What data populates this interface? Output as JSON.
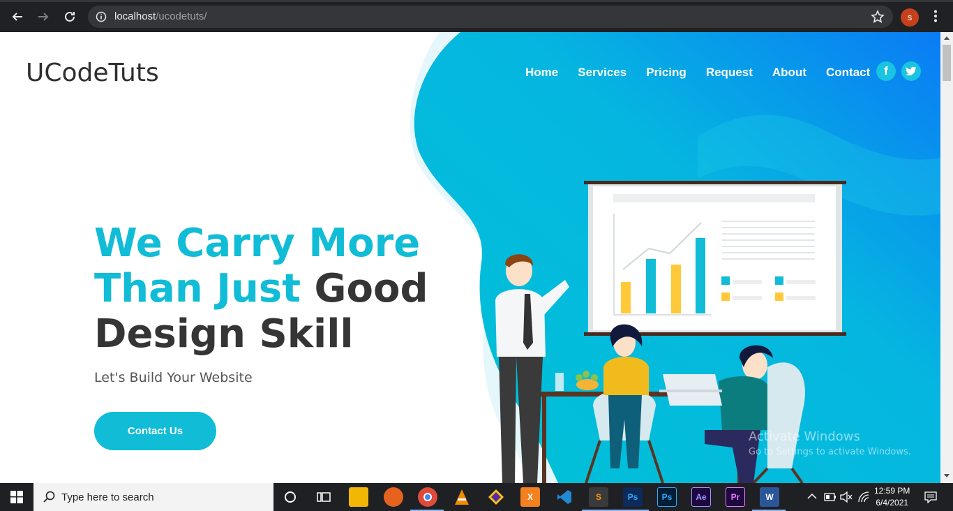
{
  "browser": {
    "url_host": "localhost",
    "url_path": "/ucodetuts/",
    "profile_initial": "s"
  },
  "site": {
    "logo": "UCodeTuts",
    "nav": [
      "Home",
      "Services",
      "Pricing",
      "Request",
      "About",
      "Contact"
    ],
    "social": [
      "f",
      "t"
    ],
    "hero": {
      "line1": "We Carry More",
      "line2_accent": "Than Just",
      "line2_rest": "Good",
      "line3": "Design Skill",
      "subtitle": "Let's Build Your Website",
      "cta": "Contact Us"
    },
    "colors": {
      "accent": "#10bcd6",
      "blob_start": "#00c2d6",
      "blob_end": "#0a7cf5"
    }
  },
  "windows": {
    "watermark_title": "Activate Windows",
    "watermark_sub": "Go to Settings to activate Windows.",
    "search_placeholder": "Type here to search",
    "time": "12:59 PM",
    "date": "6/4/2021",
    "taskbar_icons": [
      "cortana-icon",
      "task-view-icon",
      "file-explorer-icon",
      "firefox-icon",
      "chrome-icon",
      "vlc-icon",
      "git-icon",
      "xampp-icon",
      "vscode-icon",
      "sublime-icon",
      "photoshop-icon",
      "photoshop-icon-2",
      "after-effects-icon",
      "premiere-icon",
      "word-icon"
    ]
  }
}
